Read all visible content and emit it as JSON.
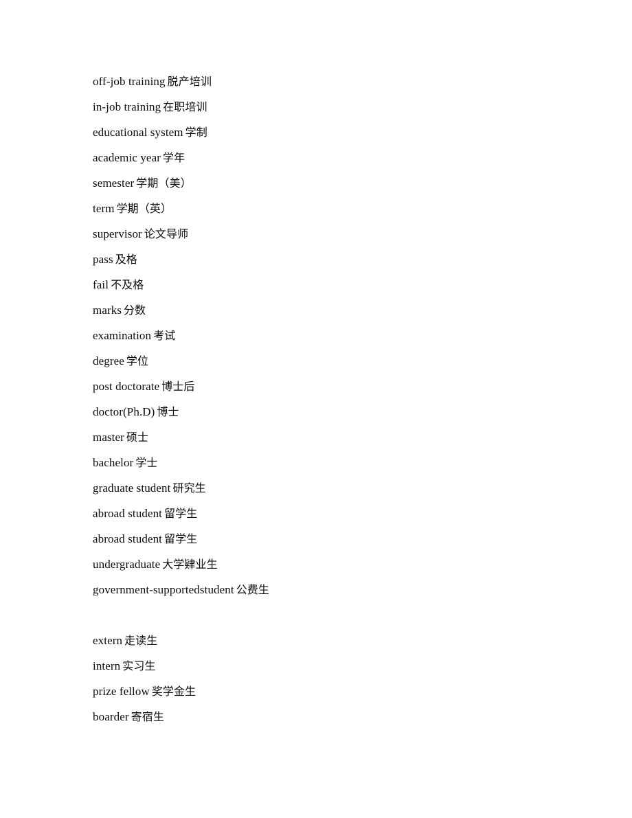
{
  "document": {
    "background_color": "#ffffff",
    "text_color": "#0d0d0d",
    "entries": [
      {
        "term": "off-job training",
        "gloss": "脱产培训"
      },
      {
        "term": "in-job training",
        "gloss": "在职培训"
      },
      {
        "term": "educational system",
        "gloss": "学制"
      },
      {
        "term": "academic year",
        "gloss": "学年"
      },
      {
        "term": "semester",
        "gloss": "学期（美）"
      },
      {
        "term": "term",
        "gloss": "学期（英）"
      },
      {
        "term": "supervisor",
        "gloss": "论文导师"
      },
      {
        "term": "pass",
        "gloss": "及格"
      },
      {
        "term": "fail",
        "gloss": "不及格"
      },
      {
        "term": "marks",
        "gloss": "分数"
      },
      {
        "term": "examination",
        "gloss": "考试"
      },
      {
        "term": "degree",
        "gloss": "学位"
      },
      {
        "term": "post doctorate",
        "gloss": "博士后"
      },
      {
        "term": "doctor(Ph.D)",
        "gloss": "博士"
      },
      {
        "term": "master",
        "gloss": "硕士"
      },
      {
        "term": "bachelor",
        "gloss": "学士"
      },
      {
        "term": "graduate student",
        "gloss": "研究生"
      },
      {
        "term": "abroad student",
        "gloss": "留学生"
      },
      {
        "term": "abroad student",
        "gloss": "留学生"
      },
      {
        "term": "undergraduate",
        "gloss": "大学肄业生"
      },
      {
        "term": "government-supportedstudent",
        "gloss": "公费生"
      },
      {
        "term": "",
        "gloss": ""
      },
      {
        "term": "extern",
        "gloss": "走读生"
      },
      {
        "term": "intern",
        "gloss": "实习生"
      },
      {
        "term": "prize fellow",
        "gloss": "奖学金生"
      },
      {
        "term": "boarder",
        "gloss": "寄宿生"
      }
    ]
  }
}
